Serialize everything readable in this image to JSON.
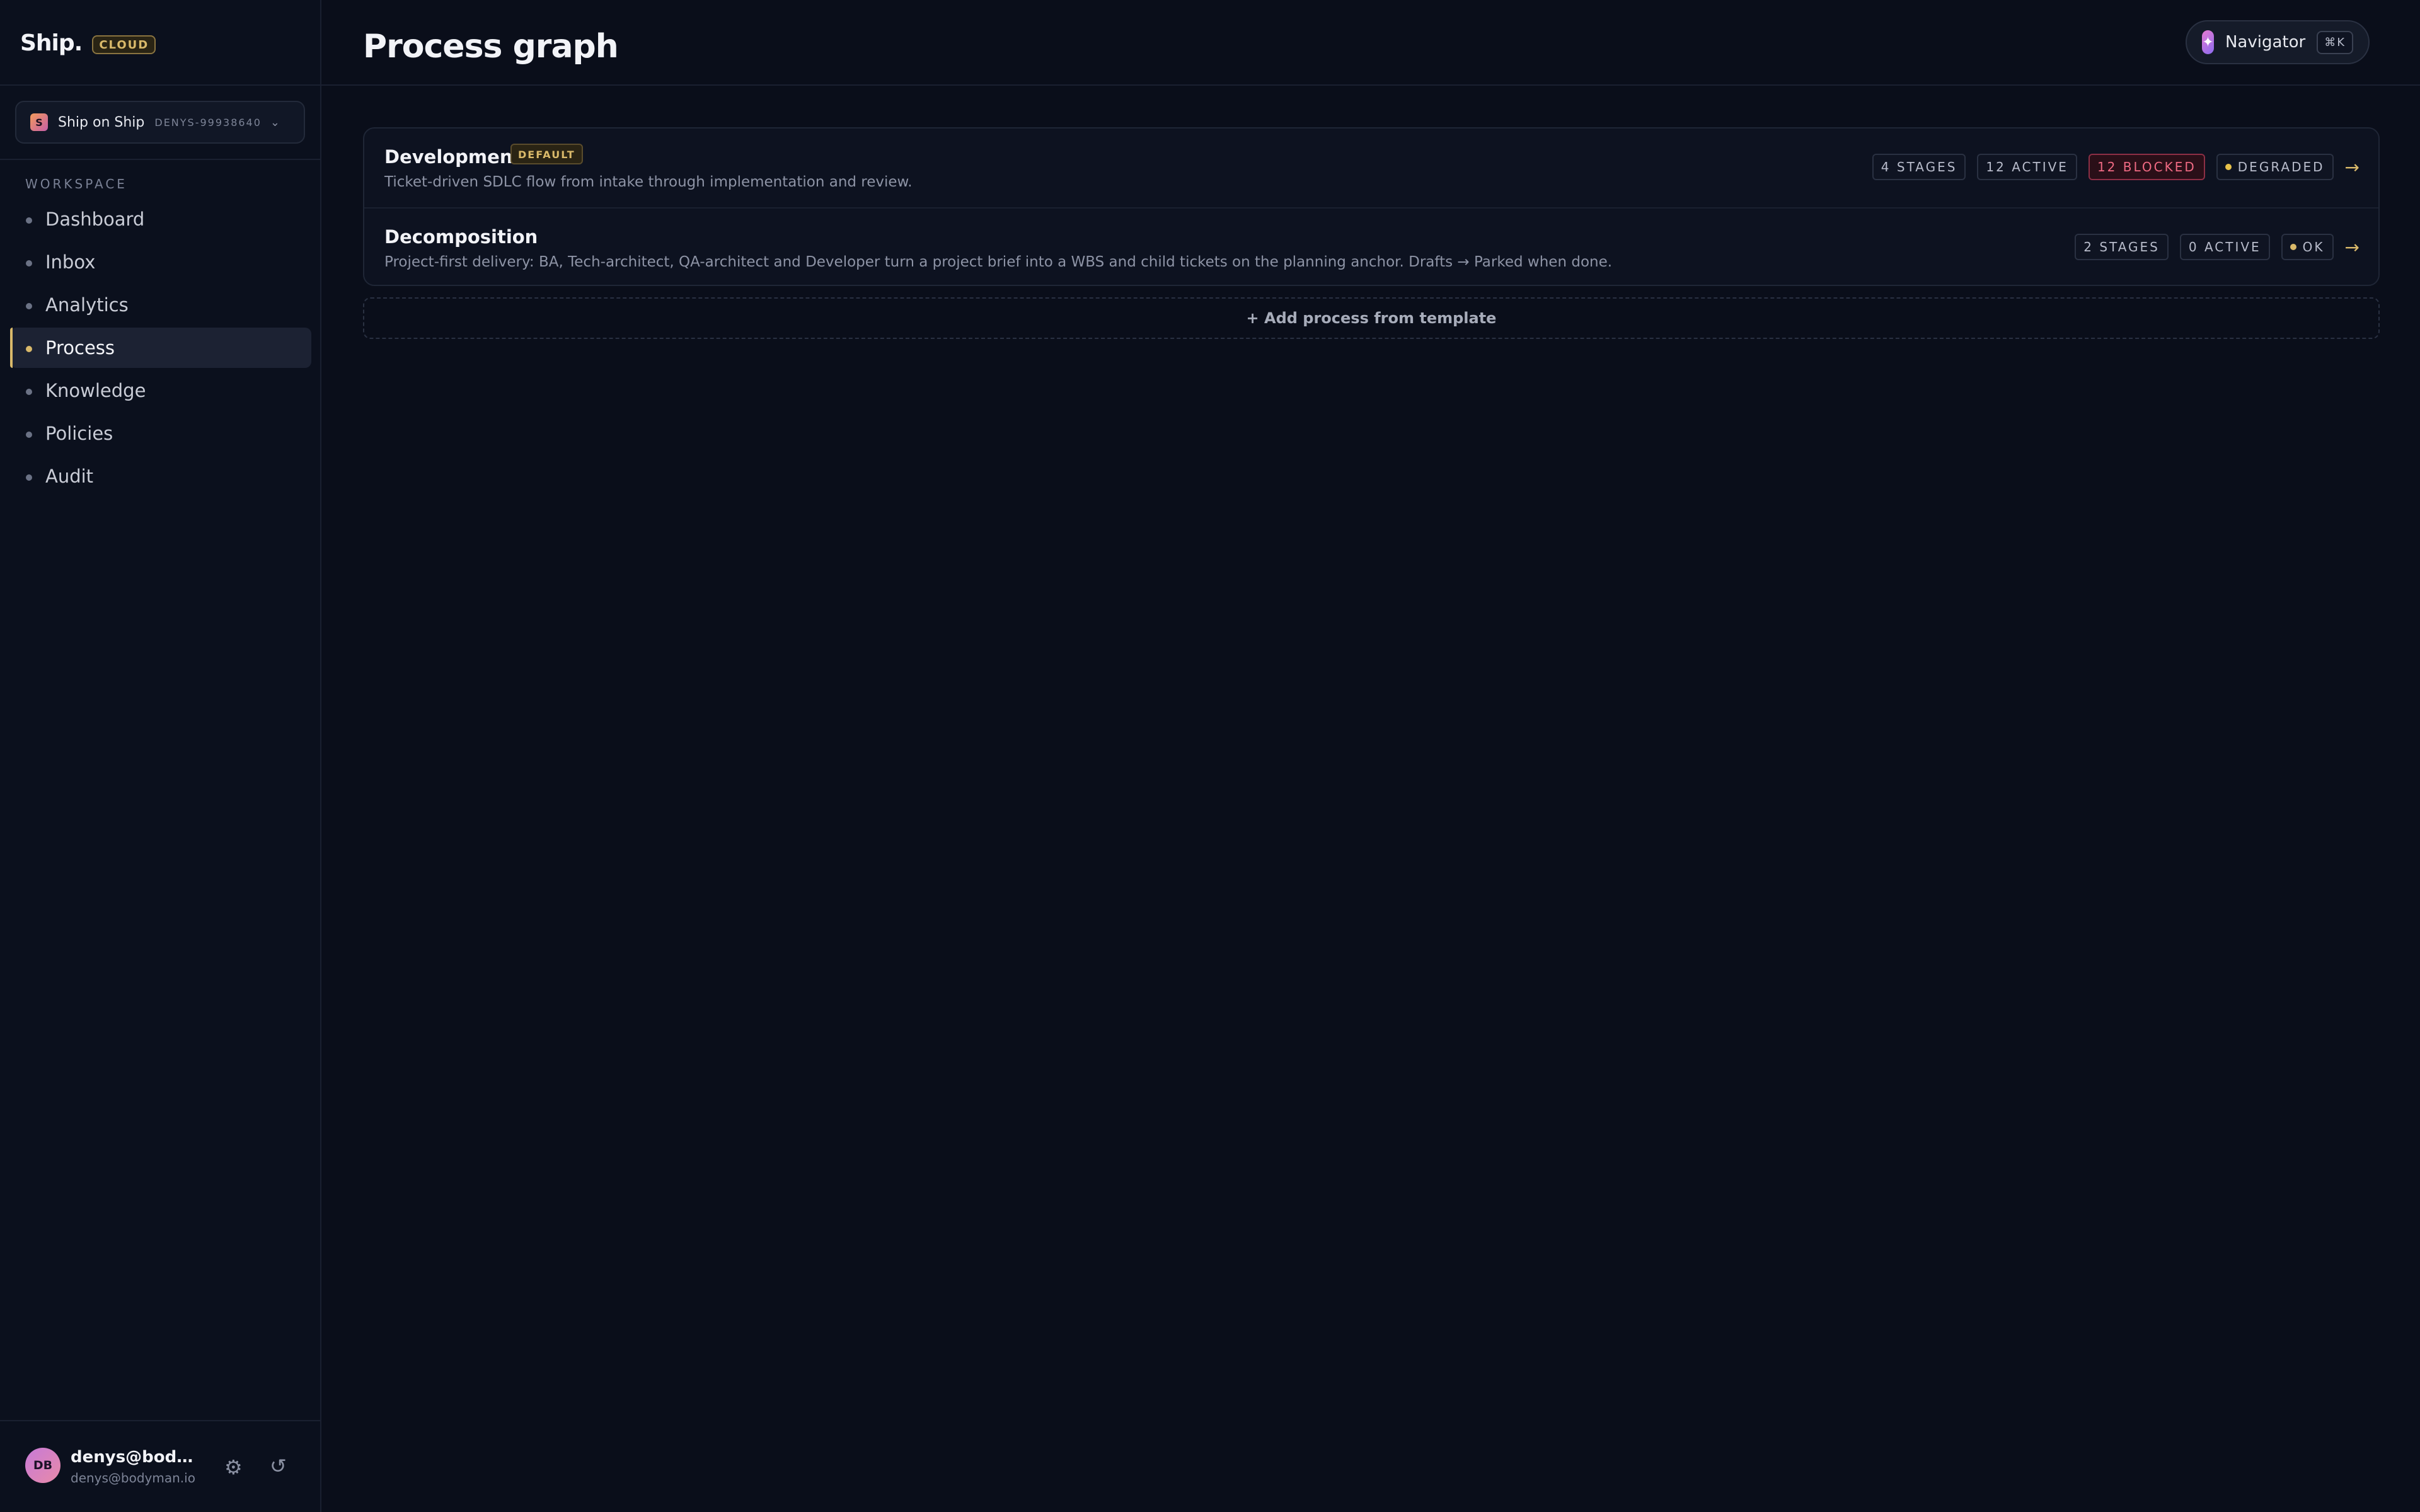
{
  "brand": {
    "name": "Ship.",
    "badge": "CLOUD"
  },
  "workspace_switcher": {
    "logo": "S",
    "name": "Ship on Ship",
    "id": "DENYS-99938640",
    "chevron": "⌄"
  },
  "sidebar": {
    "section_label": "WORKSPACE",
    "items": [
      {
        "label": "Dashboard",
        "active": false
      },
      {
        "label": "Inbox",
        "active": false
      },
      {
        "label": "Analytics",
        "active": false
      },
      {
        "label": "Process",
        "active": true
      },
      {
        "label": "Knowledge",
        "active": false
      },
      {
        "label": "Policies",
        "active": false
      },
      {
        "label": "Audit",
        "active": false
      }
    ]
  },
  "user": {
    "initials": "DB",
    "name": "denys@bodyman.io",
    "email": "denys@bodyman.io",
    "settings_icon": "gear-icon",
    "refresh_icon": "history-icon"
  },
  "header": {
    "title": "Process graph",
    "navigator": {
      "label": "Navigator",
      "shortcut": "⌘K",
      "icon": "sparkle-icon"
    }
  },
  "processes": [
    {
      "title": "Development",
      "badge": "DEFAULT",
      "description": "Ticket-driven SDLC flow from intake through implementation and review.",
      "stages": "4 STAGES",
      "active": "12 ACTIVE",
      "blocked": "12 BLOCKED",
      "status": "DEGRADED",
      "status_color": "#e8c24a",
      "arrow": "→"
    },
    {
      "title": "Decomposition",
      "description": "Project-first delivery: BA, Tech-architect, QA-architect and Developer turn a project brief into a WBS and child tickets on the planning anchor. Drafts → Parked when done.",
      "stages": "2 STAGES",
      "active": "0 ACTIVE",
      "status": "OK",
      "status_color": "#d9b96a",
      "arrow": "→"
    }
  ],
  "add_process_label": "+ Add process from template",
  "colors": {
    "accent": "#d9b96a",
    "background": "#0a0e1a",
    "blocked": "#f06a83"
  }
}
